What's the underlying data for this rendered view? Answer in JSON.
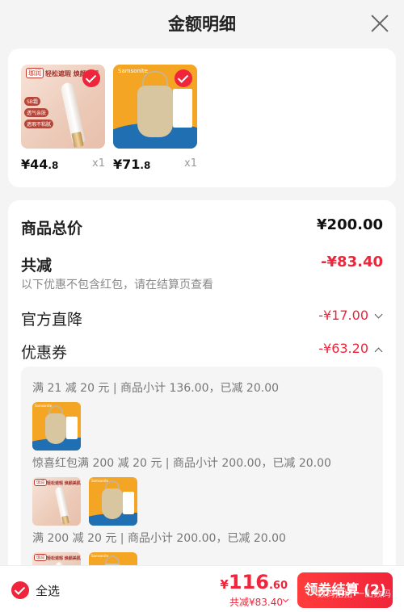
{
  "header": {
    "title": "金额明细"
  },
  "products": [
    {
      "price_main": "¥44",
      "price_dec": ".8",
      "qty": "x1",
      "brand": "珈润",
      "slogan": "轻松遮瑕 焕颜美肌",
      "tags": [
        "SB霜",
        "透气亲肤",
        "遮瑕不粘腻"
      ]
    },
    {
      "price_main": "¥71",
      "price_dec": ".8",
      "qty": "x1",
      "brand": "Samsonite"
    }
  ],
  "summary": {
    "total_label": "商品总价",
    "total_value": "¥200.00",
    "reduce_label": "共减",
    "reduce_value": "-¥83.40",
    "note": "以下优惠不包含红包，请在结算页查看",
    "official_label": "官方直降",
    "official_value": "-¥17.00",
    "coupon_label": "优惠券",
    "coupon_value": "-¥63.20"
  },
  "coupons": [
    {
      "text": "满 21 减 20 元 | 商品小计 136.00，已减 20.00"
    },
    {
      "text": "惊喜红包满 200 减 20 元 | 商品小计 200.00，已减 20.00"
    },
    {
      "text": "满 200 减 20 元 | 商品小计 200.00，已减 20.00"
    }
  ],
  "footer": {
    "select_all": "全选",
    "currency": "¥",
    "amount_int": "116",
    "amount_dec": ".60",
    "saved": "共减¥83.40",
    "button": "领券结算 (2)",
    "overlay_text": "数码扭扭 一山数码"
  },
  "colors": {
    "accent": "#f0243a",
    "background": "#f4f4f4"
  }
}
